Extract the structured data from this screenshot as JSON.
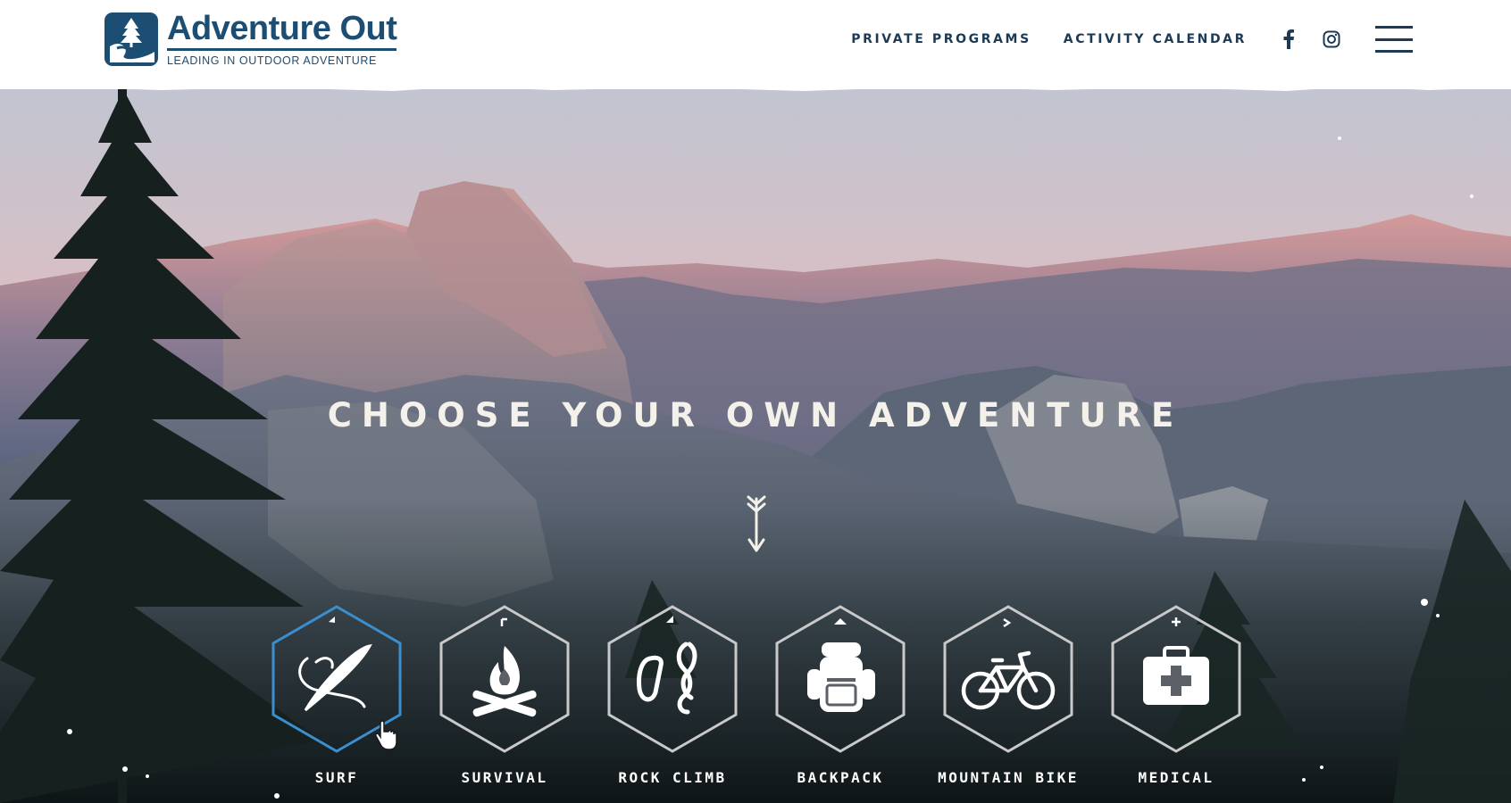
{
  "brand": {
    "name": "Adventure Out",
    "tagline": "LEADING IN OUTDOOR ADVENTURE",
    "color": "#1c4d72"
  },
  "nav": {
    "links": [
      {
        "label": "PRIVATE PROGRAMS"
      },
      {
        "label": "ACTIVITY CALENDAR"
      }
    ],
    "social_icons": [
      "facebook-icon",
      "instagram-icon"
    ],
    "menu_icon": "hamburger-menu-icon"
  },
  "hero": {
    "title": "CHOOSE YOUR OWN ADVENTURE",
    "scroll_icon": "arrow-down-icon"
  },
  "activities": [
    {
      "label": "SURF",
      "icon": "surfboard-icon",
      "active": true
    },
    {
      "label": "SURVIVAL",
      "icon": "campfire-icon",
      "active": false
    },
    {
      "label": "ROCK CLIMB",
      "icon": "carabiner-rope-icon",
      "active": false
    },
    {
      "label": "BACKPACK",
      "icon": "backpack-icon",
      "active": false
    },
    {
      "label": "MOUNTAIN BIKE",
      "icon": "bicycle-icon",
      "active": false
    },
    {
      "label": "MEDICAL",
      "icon": "first-aid-kit-icon",
      "active": false
    }
  ],
  "colors": {
    "header_bg": "#ffffff",
    "nav_text": "#1c3a55",
    "hex_active": "#3b8fcf",
    "hex_inactive": "#c9c9c9",
    "title_text": "#f4f1ea"
  }
}
